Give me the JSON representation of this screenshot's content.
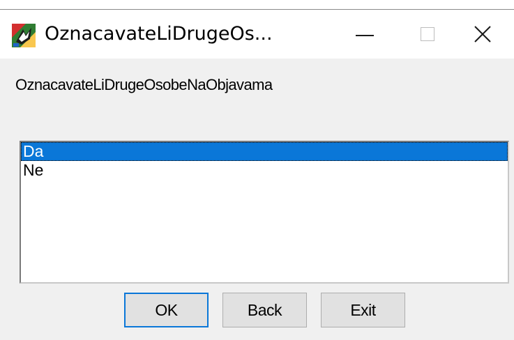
{
  "window": {
    "title": "OznacavateLiDrugeOs...",
    "controls": {
      "minimize_icon": "minimize-icon",
      "maximize_icon": "maximize-icon",
      "close_icon": "close-icon",
      "close_glyph": "✕"
    }
  },
  "dialog": {
    "prompt": "OznacavateLiDrugeOsobeNaObjavama",
    "list": {
      "items": [
        {
          "label": "Da",
          "selected": true
        },
        {
          "label": "Ne",
          "selected": false
        }
      ]
    },
    "buttons": {
      "ok": "OK",
      "back": "Back",
      "exit": "Exit"
    }
  },
  "colors": {
    "selection": "#0a77d8",
    "window_bg": "#f0f0f0",
    "titlebar_bg": "#ffffff",
    "button_bg": "#e1e1e1",
    "default_button_border": "#0a77d8"
  }
}
